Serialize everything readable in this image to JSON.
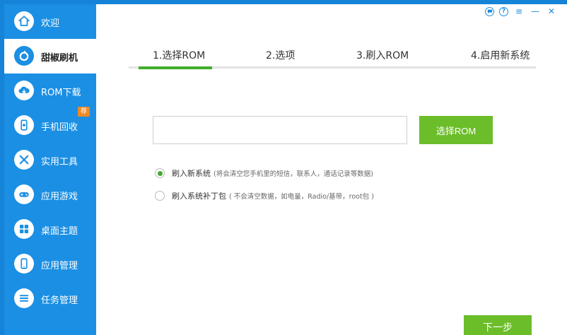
{
  "sidebar": {
    "items": [
      {
        "label": "欢迎",
        "icon": "home-icon"
      },
      {
        "label": "甜椒刷机",
        "icon": "flash-refresh-icon",
        "active": true
      },
      {
        "label": "ROM下载",
        "icon": "cloud-download-icon"
      },
      {
        "label": "手机回收",
        "icon": "phone-recycle-icon",
        "badge": "荐"
      },
      {
        "label": "实用工具",
        "icon": "tools-icon"
      },
      {
        "label": "应用游戏",
        "icon": "gamepad-icon"
      },
      {
        "label": "桌面主题",
        "icon": "grid-icon"
      },
      {
        "label": "应用管理",
        "icon": "phone-icon"
      },
      {
        "label": "任务管理",
        "icon": "list-icon"
      }
    ]
  },
  "window_controls": {
    "chat": "chat-icon",
    "help": "?",
    "menu": "≡",
    "minimize": "—",
    "close": "✕"
  },
  "steps": [
    "1.选择ROM",
    "2.选项",
    "3.刷入ROM",
    "4.启用新系统"
  ],
  "rom": {
    "input_value": "",
    "select_button": "选择ROM"
  },
  "options": [
    {
      "label": "刷入新系统",
      "note": "(将会清空您手机里的短信，联系人，通话记录等数据)",
      "selected": true
    },
    {
      "label": "刷入系统补丁包",
      "note": "( 不会清空数据，如电量，Radio/基带，root包 )",
      "selected": false
    }
  ],
  "next_button": "下一步",
  "colors": {
    "sidebar": "#1b8fe3",
    "accent_green": "#6cbd2a",
    "progress_green": "#3fae2a"
  }
}
